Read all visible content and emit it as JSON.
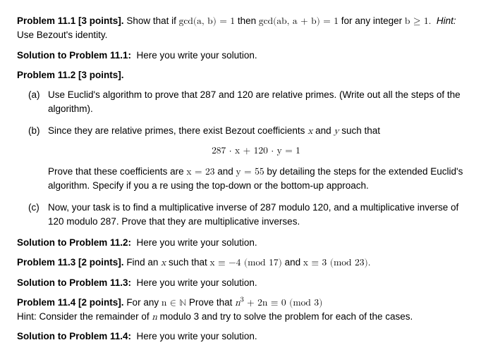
{
  "p111": {
    "heading": "Problem 11.1 [3 points].",
    "text_a": "Show that if ",
    "math_a": "gcd(a, b) = 1",
    "text_b": " then ",
    "math_b": "gcd(ab, a + b) = 1",
    "text_c": " for any integer ",
    "math_c": "b ≥ 1.",
    "hint_label": "Hint:",
    "hint_text": "Use Bezout's identity.",
    "sol_label": "Solution to Problem 11.1:",
    "sol_text": "Here you write your solution."
  },
  "p112": {
    "heading": "Problem 11.2 [3 points].",
    "a": {
      "marker": "(a)",
      "text": "Use Euclid's algorithm to prove that 287 and 120 are relative primes. (Write out all the steps of the algorithm)."
    },
    "b": {
      "marker": "(b)",
      "text_a": "Since they are relative primes, there exist Bezout coefficients ",
      "var_x": "x",
      "text_b": " and ",
      "var_y": "y",
      "text_c": " such that",
      "eq": "287 · x + 120 · y = 1",
      "text_d": "Prove that these coefficients are ",
      "math_d": "x = 23",
      "text_e": " and ",
      "math_e": "y = 55",
      "text_f": " by detailing the steps for the extended Euclid's algorithm. Specify if you a re using the top-down or the bottom-up approach."
    },
    "c": {
      "marker": "(c)",
      "text": "Now, your task is to find a multiplicative inverse of 287 modulo 120, and a multiplicative inverse of 120 modulo 287. Prove that they are multiplicative inverses."
    },
    "sol_label": "Solution to Problem 11.2:",
    "sol_text": "Here you write your solution."
  },
  "p113": {
    "heading": "Problem 11.3 [2 points].",
    "text_a": "Find an ",
    "var_x": "x",
    "text_b": " such that ",
    "math_a": "x ≡ −4 (mod 17)",
    "text_c": " and ",
    "math_b": "x ≡ 3 (mod 23).",
    "sol_label": "Solution to Problem 11.3:",
    "sol_text": "Here you write your solution."
  },
  "p114": {
    "heading": "Problem 11.4 [2 points].",
    "text_a": "For any ",
    "math_a": "n ∈ ℕ",
    "text_b": " Prove that ",
    "math_b_pre": "n",
    "math_b_sup": "3",
    "math_b_suf": " + 2n ≡ 0 (mod 3)",
    "hint_text": "Hint: Consider the remainder of ",
    "hint_var": "n",
    "hint_text2": " modulo 3 and try to solve the problem for each of the cases.",
    "sol_label": "Solution to Problem 11.4:",
    "sol_text": "Here you write your solution."
  }
}
